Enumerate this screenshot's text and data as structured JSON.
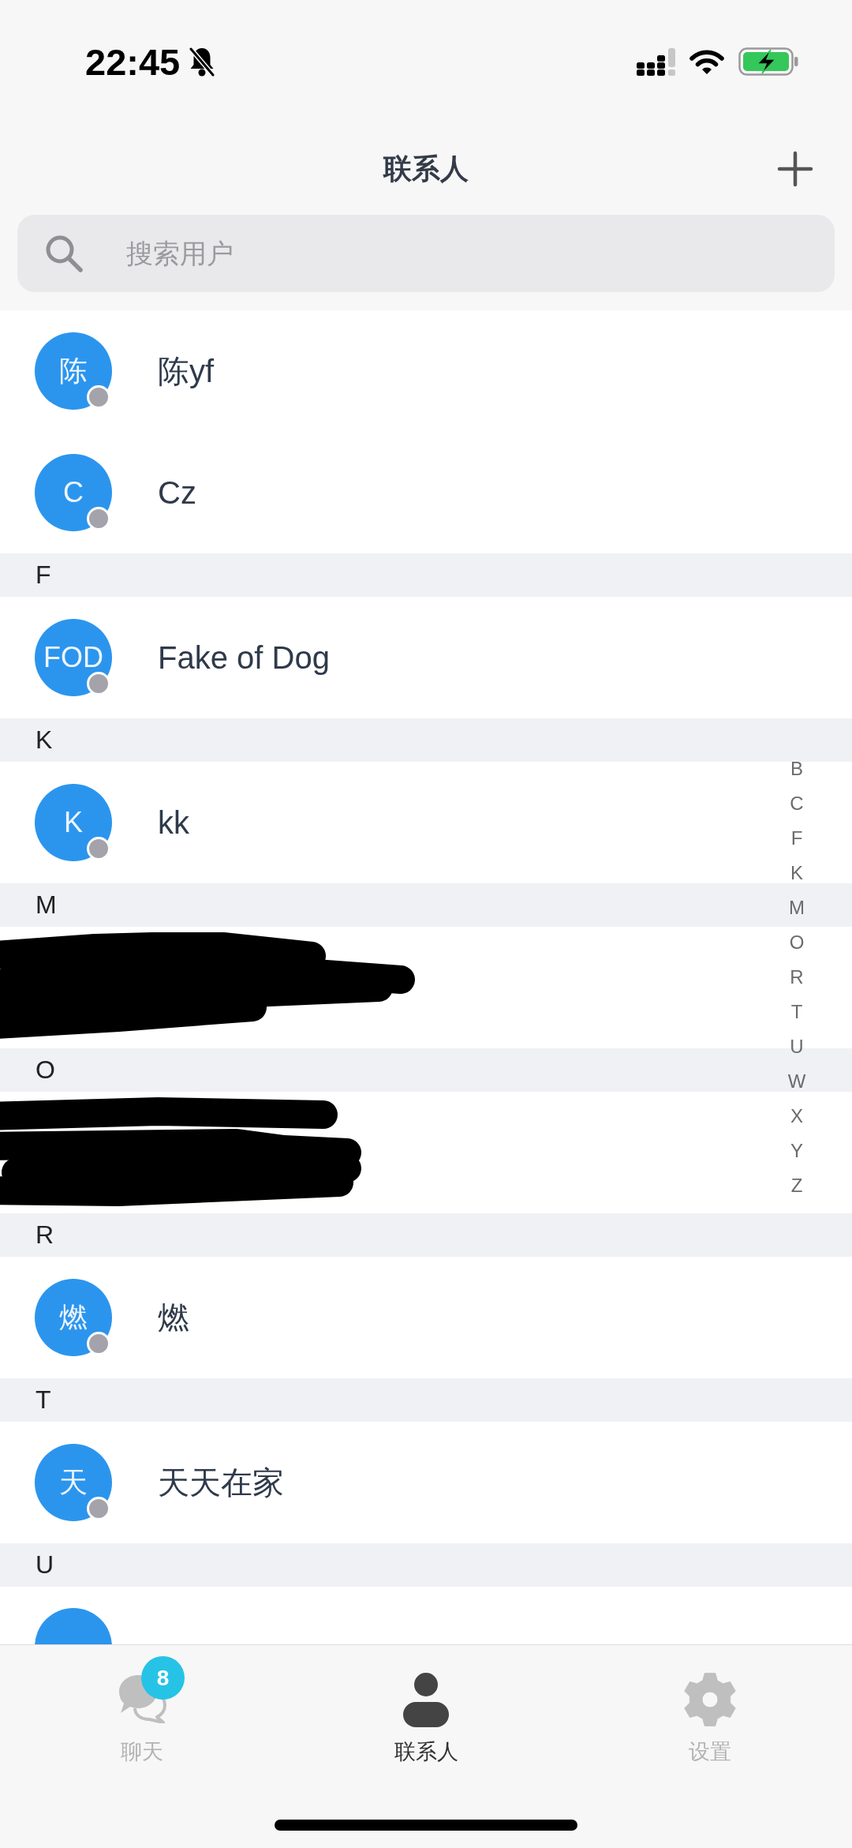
{
  "status_bar": {
    "time": "22:45"
  },
  "header": {
    "title": "联系人"
  },
  "search": {
    "placeholder": "搜索用户"
  },
  "sections": [
    {
      "rows": [
        {
          "kind": "contact",
          "initial": "陈",
          "name": "陈yf",
          "online": false
        },
        {
          "kind": "contact",
          "initial": "C",
          "name": "Cz",
          "online": false
        }
      ]
    },
    {
      "letter": "F",
      "rows": [
        {
          "kind": "contact",
          "initial": "FOD",
          "name": "Fake of Dog",
          "online": false
        }
      ]
    },
    {
      "letter": "K",
      "rows": [
        {
          "kind": "contact",
          "initial": "K",
          "name": "kk",
          "online": false
        }
      ]
    },
    {
      "letter": "M",
      "rows": [
        {
          "kind": "redacted"
        }
      ]
    },
    {
      "letter": "O",
      "rows": [
        {
          "kind": "redacted"
        }
      ]
    },
    {
      "letter": "R",
      "rows": [
        {
          "kind": "contact",
          "initial": "燃",
          "name": "燃",
          "online": false
        }
      ]
    },
    {
      "letter": "T",
      "rows": [
        {
          "kind": "contact",
          "initial": "天",
          "name": "天天在家",
          "online": false
        }
      ]
    },
    {
      "letter": "U",
      "rows": [
        {
          "kind": "clipped"
        }
      ]
    }
  ],
  "index": [
    "B",
    "C",
    "F",
    "K",
    "M",
    "O",
    "R",
    "T",
    "U",
    "W",
    "X",
    "Y",
    "Z"
  ],
  "tabs": [
    {
      "kind": "chat",
      "label": "聊天",
      "selected": false,
      "badge": "8"
    },
    {
      "kind": "contacts",
      "label": "联系人",
      "selected": true
    },
    {
      "kind": "settings",
      "label": "设置",
      "selected": false
    }
  ]
}
